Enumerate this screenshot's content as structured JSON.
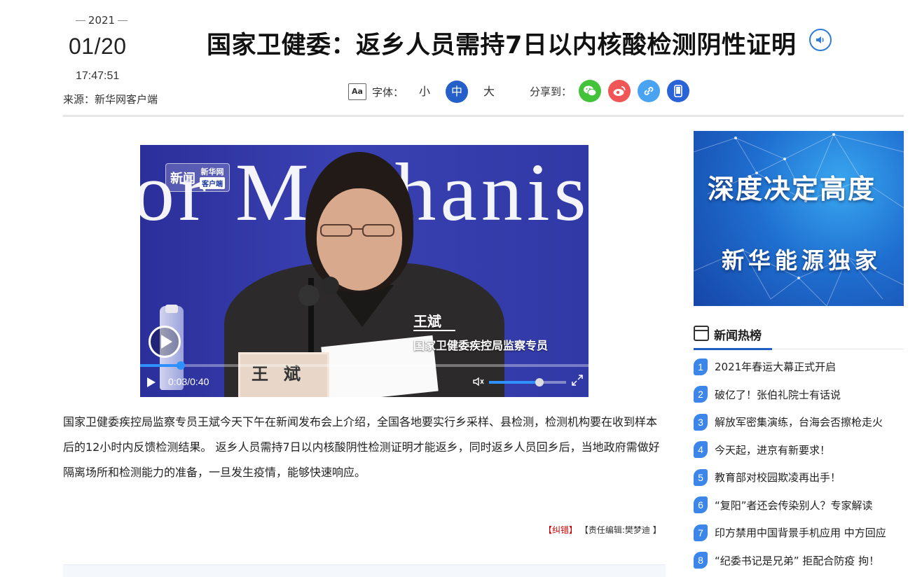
{
  "header": {
    "year": "2021",
    "date": "01/20",
    "time": "17:47:51",
    "source": "来源：新华网客户端",
    "title": "国家卫健委：返乡人员需持7日以内核酸检测阴性证明"
  },
  "toolbar": {
    "font_icon": "Aa",
    "font_label": "字体：",
    "sizes": [
      "小",
      "中",
      "大"
    ],
    "active_size": "中",
    "share_label": "分享到：",
    "share_targets": [
      "wechat-icon",
      "weibo-icon",
      "link-icon",
      "mobile-icon"
    ]
  },
  "video": {
    "background_text": "or Mechanism",
    "logo_main": "新闻",
    "logo_sub": "新华网",
    "logo_tag": "客户端",
    "speaker_name": "王斌",
    "speaker_title": "国家卫健委疾控局监察专员",
    "nameplate": "王斌",
    "time_display": "0:03/0:40",
    "progress": 0.09,
    "volume": 0.65
  },
  "article": {
    "body": "国家卫健委疾控局监察专员王斌今天下午在新闻发布会上介绍，全国各地要实行乡采样、县检测，检测机构要在收到样本后的12小时内反馈检测结果。 返乡人员需持7日以内核酸阴性检测证明才能返乡，同时返乡人员回乡后，当地政府需做好隔离场所和检测能力的准备，一旦发生疫情，能够快速响应。",
    "error_link": "【纠错】",
    "editor": "【责任编辑:樊梦迪 】"
  },
  "sidebar": {
    "ad_line1": "深度决定高度",
    "ad_line2": "新华能源独家",
    "hot_title": "新闻热榜",
    "hot_items": [
      {
        "num": "1",
        "text": "2021年春运大幕正式开启"
      },
      {
        "num": "2",
        "text": "破亿了！张伯礼院士有话说"
      },
      {
        "num": "3",
        "text": "解放军密集演练，台海会否擦枪走火"
      },
      {
        "num": "4",
        "text": "今天起，进京有新要求！"
      },
      {
        "num": "5",
        "text": "教育部对校园欺凌再出手！"
      },
      {
        "num": "6",
        "text": "“复阳”者还会传染别人？专家解读"
      },
      {
        "num": "7",
        "text": "印方禁用中国背景手机应用 中方回应"
      },
      {
        "num": "8",
        "text": "“纪委书记是兄弟” 拒配合防疫 拘！"
      }
    ]
  },
  "colors": {
    "accent": "#2560c8",
    "wechat": "#43c33a",
    "weibo": "#f05656",
    "link": "#4aa3f0",
    "mobile": "#2a62d8",
    "rank_badge": "#3b86e8"
  }
}
